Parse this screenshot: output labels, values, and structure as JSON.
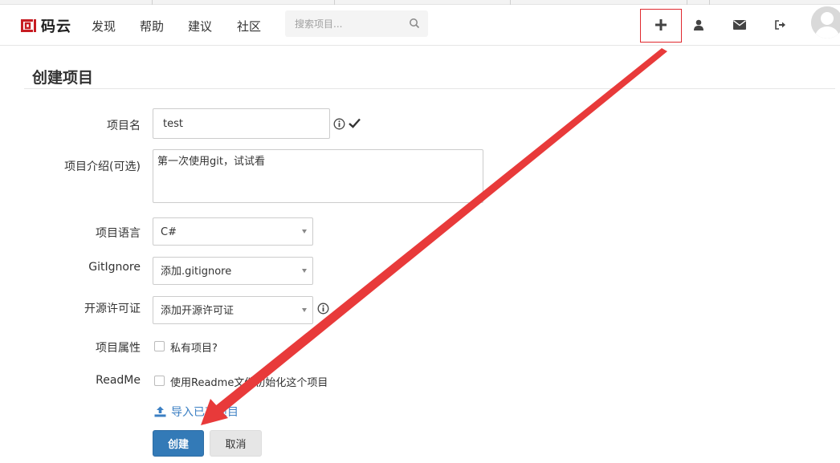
{
  "header": {
    "logo_text": "码云",
    "nav": [
      "发现",
      "帮助",
      "建议",
      "社区"
    ],
    "search_placeholder": "搜索项目..."
  },
  "page": {
    "title": "创建项目"
  },
  "form": {
    "name_label": "项目名",
    "name_value": "test",
    "desc_label": "项目介绍(可选)",
    "desc_value": "第一次使用git，试试看",
    "lang_label": "项目语言",
    "lang_value": "C#",
    "gitignore_label": "GitIgnore",
    "gitignore_value": "添加.gitignore",
    "license_label": "开源许可证",
    "license_value": "添加开源许可证",
    "attr_label": "项目属性",
    "private_label": "私有项目?",
    "readme_label": "ReadMe",
    "readme_option": "使用Readme文件初始化这个项目",
    "import_link": "导入已有项目",
    "create_button": "创建",
    "cancel_button": "取消"
  },
  "colors": {
    "brand_red": "#c71d23",
    "primary_blue": "#337ab7",
    "link_blue": "#3b7fc3",
    "annotation_red": "#e0292f"
  }
}
